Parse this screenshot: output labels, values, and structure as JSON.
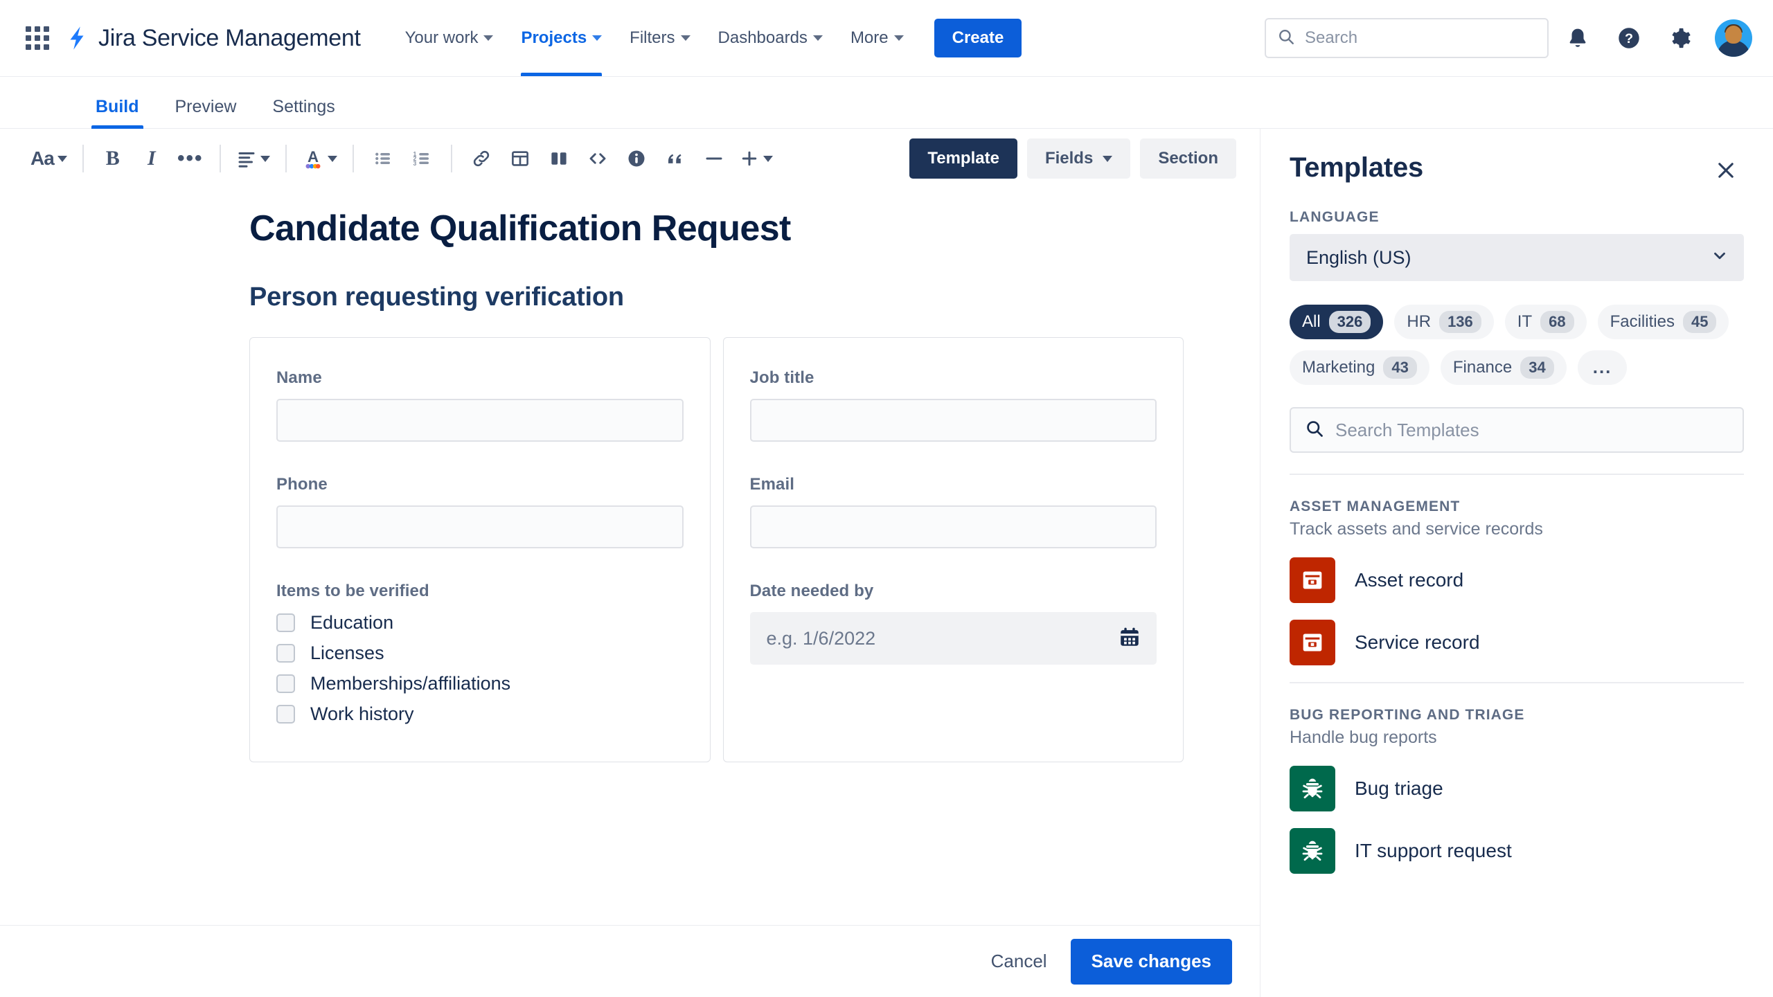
{
  "topnav": {
    "app_icon": "app-switcher-icon",
    "product_logo_icon": "jira-bolt-icon",
    "product_name": "Jira Service Management",
    "items": [
      {
        "label": "Your work",
        "has_chevron": true,
        "active": false
      },
      {
        "label": "Projects",
        "has_chevron": true,
        "active": true
      },
      {
        "label": "Filters",
        "has_chevron": true,
        "active": false
      },
      {
        "label": "Dashboards",
        "has_chevron": true,
        "active": false
      },
      {
        "label": "More",
        "has_chevron": true,
        "active": false
      }
    ],
    "create_label": "Create",
    "search_placeholder": "Search",
    "icons": [
      "notifications-bell-icon",
      "help-question-icon",
      "settings-gear-icon",
      "user-avatar"
    ],
    "accent_blue": "#0c5ed9"
  },
  "subtabs": [
    {
      "label": "Build",
      "active": true
    },
    {
      "label": "Preview",
      "active": false
    },
    {
      "label": "Settings",
      "active": false
    }
  ],
  "toolbar": {
    "groups": [
      [
        "text-style-icon"
      ],
      [
        "bold-icon",
        "italic-icon",
        "more-formatting-icon"
      ],
      [
        "text-align-icon"
      ],
      [
        "text-color-icon"
      ],
      [
        "bullet-list-icon",
        "numbered-list-icon"
      ],
      [
        "link-icon",
        "table-icon",
        "layout-columns-icon",
        "code-icon",
        "info-panel-icon",
        "quote-icon",
        "horizontal-rule-icon",
        "insert-plus-icon"
      ]
    ],
    "text_style_label": "Aa",
    "bold_label": "B",
    "italic_label": "I",
    "modes": [
      {
        "label": "Template",
        "active": true,
        "has_chevron": false
      },
      {
        "label": "Fields",
        "active": false,
        "has_chevron": true
      },
      {
        "label": "Section",
        "active": false,
        "has_chevron": false
      }
    ]
  },
  "form": {
    "title": "Candidate Qualification Request",
    "section_heading": "Person requesting verification",
    "left_card": {
      "fields": [
        {
          "label": "Name",
          "type": "text",
          "value": "",
          "placeholder": ""
        },
        {
          "label": "Phone",
          "type": "text",
          "value": "",
          "placeholder": ""
        }
      ],
      "checkbox_group": {
        "label": "Items to be verified",
        "options": [
          {
            "label": "Education",
            "checked": false
          },
          {
            "label": "Licenses",
            "checked": false
          },
          {
            "label": "Memberships/affiliations",
            "checked": false
          },
          {
            "label": "Work history",
            "checked": false
          }
        ]
      }
    },
    "right_card": {
      "fields": [
        {
          "label": "Job title",
          "type": "text",
          "value": "",
          "placeholder": ""
        },
        {
          "label": "Email",
          "type": "text",
          "value": "",
          "placeholder": ""
        }
      ],
      "date_field": {
        "label": "Date needed by",
        "placeholder": "e.g. 1/6/2022",
        "icon": "calendar-icon"
      }
    }
  },
  "footer": {
    "cancel_label": "Cancel",
    "save_label": "Save changes"
  },
  "templates_panel": {
    "title": "Templates",
    "close_icon": "close-icon",
    "language_label": "LANGUAGE",
    "language_value": "English (US)",
    "category_chips": [
      {
        "label": "All",
        "count": "326",
        "selected": true
      },
      {
        "label": "HR",
        "count": "136",
        "selected": false
      },
      {
        "label": "IT",
        "count": "68",
        "selected": false
      },
      {
        "label": "Facilities",
        "count": "45",
        "selected": false
      },
      {
        "label": "Marketing",
        "count": "43",
        "selected": false
      },
      {
        "label": "Finance",
        "count": "34",
        "selected": false
      },
      {
        "label": "...",
        "count": "",
        "selected": false
      }
    ],
    "search_placeholder": "Search Templates",
    "search_icon": "search-icon",
    "groups": [
      {
        "title": "ASSET MANAGEMENT",
        "subtitle": "Track assets and service records",
        "icon_color": "#bf2600",
        "icon_name": "asset-box-icon",
        "items": [
          {
            "name": "Asset record"
          },
          {
            "name": "Service record"
          }
        ]
      },
      {
        "title": "BUG REPORTING AND TRIAGE",
        "subtitle": "Handle bug reports",
        "icon_color": "#00694c",
        "icon_name": "bug-icon",
        "items": [
          {
            "name": "Bug triage"
          },
          {
            "name": "IT support request"
          }
        ]
      }
    ]
  }
}
